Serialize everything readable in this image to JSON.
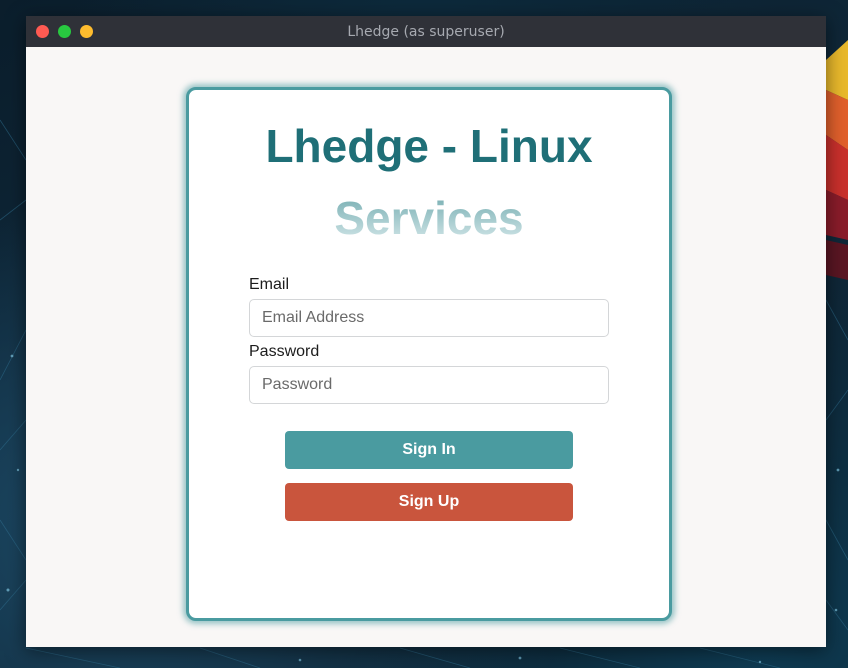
{
  "window": {
    "title": "Lhedge (as superuser)"
  },
  "login": {
    "title_line1": "Lhedge - Linux",
    "title_line2": "Services",
    "email_label": "Email",
    "email_placeholder": "Email Address",
    "email_value": "",
    "password_label": "Password",
    "password_placeholder": "Password",
    "password_value": "",
    "sign_in_label": "Sign In",
    "sign_up_label": "Sign Up"
  },
  "colors": {
    "accent": "#4a9ba0",
    "title": "#1f6f77",
    "sign_up": "#c9553d",
    "titlebar": "#2f3138"
  }
}
